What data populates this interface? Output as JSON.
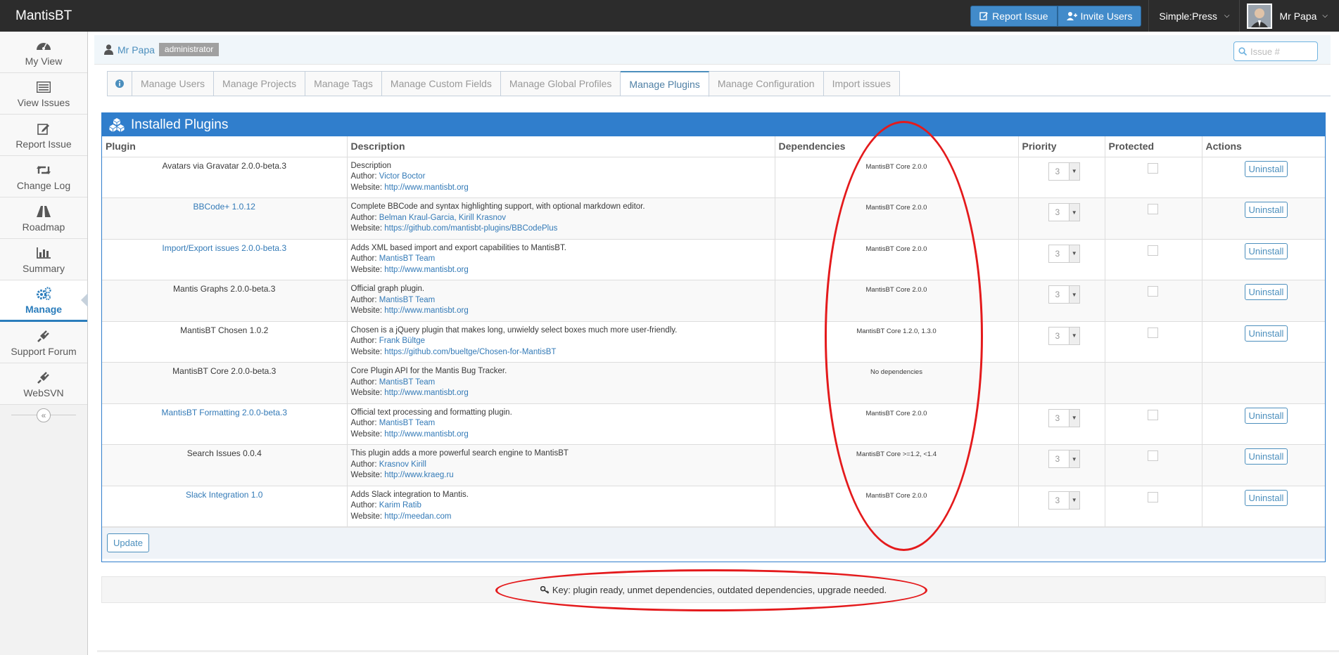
{
  "app": {
    "title": "MantisBT"
  },
  "topbar": {
    "report_issue": "Report Issue",
    "invite_users": "Invite Users",
    "project": "Simple:Press",
    "user": "Mr Papa"
  },
  "sidebar": {
    "items": [
      {
        "label": "My View",
        "icon": "dashboard-icon"
      },
      {
        "label": "View Issues",
        "icon": "list-icon"
      },
      {
        "label": "Report Issue",
        "icon": "edit-icon"
      },
      {
        "label": "Change Log",
        "icon": "retweet-icon"
      },
      {
        "label": "Roadmap",
        "icon": "road-icon"
      },
      {
        "label": "Summary",
        "icon": "bar-chart-icon"
      },
      {
        "label": "Manage",
        "icon": "gears-icon",
        "active": true
      },
      {
        "label": "Support Forum",
        "icon": "plug-icon"
      },
      {
        "label": "WebSVN",
        "icon": "plug-icon"
      }
    ]
  },
  "breadcrumb": {
    "user": "Mr Papa",
    "role": "administrator"
  },
  "search": {
    "placeholder": "Issue #"
  },
  "tabs": [
    "Manage Users",
    "Manage Projects",
    "Manage Tags",
    "Manage Custom Fields",
    "Manage Global Profiles",
    "Manage Plugins",
    "Manage Configuration",
    "Import issues"
  ],
  "widget": {
    "title": "Installed Plugins",
    "columns": [
      "Plugin",
      "Description",
      "Dependencies",
      "Priority",
      "Protected",
      "Actions"
    ],
    "rows": [
      {
        "name": "Avatars via Gravatar 2.0.0-beta.3",
        "link": false,
        "desc": "Description",
        "author": "Victor Boctor",
        "website": "http://www.mantisbt.org",
        "dep": "MantisBT Core 2.0.0",
        "priority": "3",
        "action": "Uninstall"
      },
      {
        "name": "BBCode+ 1.0.12",
        "link": true,
        "desc": "Complete BBCode and syntax highlighting support, with optional markdown editor.",
        "author": "Belman Kraul-Garcia, Kirill Krasnov",
        "website": "https://github.com/mantisbt-plugins/BBCodePlus",
        "dep": "MantisBT Core 2.0.0",
        "priority": "3",
        "action": "Uninstall"
      },
      {
        "name": "Import/Export issues 2.0.0-beta.3",
        "link": true,
        "desc": "Adds XML based import and export capabilities to MantisBT.",
        "author": "MantisBT Team",
        "website": "http://www.mantisbt.org",
        "dep": "MantisBT Core 2.0.0",
        "priority": "3",
        "action": "Uninstall"
      },
      {
        "name": "Mantis Graphs 2.0.0-beta.3",
        "link": false,
        "desc": "Official graph plugin.",
        "author": "MantisBT Team",
        "website": "http://www.mantisbt.org",
        "dep": "MantisBT Core 2.0.0",
        "priority": "3",
        "action": "Uninstall"
      },
      {
        "name": "MantisBT Chosen 1.0.2",
        "link": false,
        "desc": "Chosen is a jQuery plugin that makes long, unwieldy select boxes much more user-friendly.",
        "author": "Frank Bültge",
        "website": "https://github.com/bueltge/Chosen-for-MantisBT",
        "dep": "MantisBT Core 1.2.0, 1.3.0",
        "priority": "3",
        "action": "Uninstall"
      },
      {
        "name": "MantisBT Core 2.0.0-beta.3",
        "link": false,
        "desc": "Core Plugin API for the Mantis Bug Tracker.",
        "author": "MantisBT Team",
        "website": "http://www.mantisbt.org",
        "dep": "No dependencies",
        "priority": "",
        "action": ""
      },
      {
        "name": "MantisBT Formatting 2.0.0-beta.3",
        "link": true,
        "desc": "Official text processing and formatting plugin.",
        "author": "MantisBT Team",
        "website": "http://www.mantisbt.org",
        "dep": "MantisBT Core 2.0.0",
        "priority": "3",
        "action": "Uninstall"
      },
      {
        "name": "Search Issues 0.0.4",
        "link": false,
        "desc": "This plugin adds a more powerful search engine to MantisBT",
        "author": "Krasnov Kirill",
        "website": "http://www.kraeg.ru",
        "dep": "MantisBT Core >=1.2, <1.4",
        "priority": "3",
        "action": "Uninstall"
      },
      {
        "name": "Slack Integration 1.0",
        "link": true,
        "desc": "Adds Slack integration to Mantis.",
        "author": "Karim Ratib",
        "website": "http://meedan.com",
        "dep": "MantisBT Core 2.0.0",
        "priority": "3",
        "action": "Uninstall"
      }
    ],
    "author_label": "Author: ",
    "website_label": "Website: ",
    "update_button": "Update"
  },
  "key": {
    "text": "Key: plugin ready, unmet dependencies, outdated dependencies, upgrade needed."
  },
  "colors": {
    "topbar": "#2c2c2c",
    "primary": "#307ecc",
    "link": "#337ab7",
    "annotation": "#e41a1c"
  }
}
